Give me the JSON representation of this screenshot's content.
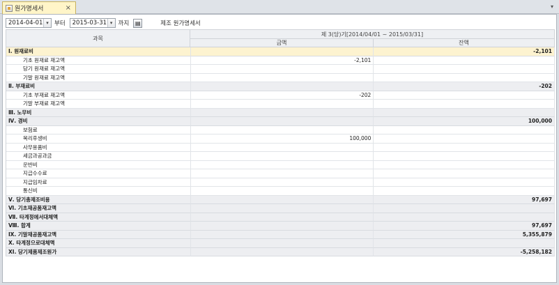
{
  "tab": {
    "label": "원가명세서",
    "close": "×",
    "menu": "▾"
  },
  "filter": {
    "from": "2014-04-01",
    "from_suffix": "부터",
    "to": "2015-03-31",
    "to_suffix": "까지",
    "print_icon": "printer-icon",
    "report_title": "제조 원가명세서"
  },
  "header": {
    "item_col": "과목",
    "period": "제 3(당)기[2014/04/01 ~ 2015/03/31]",
    "amount_col": "금액",
    "balance_col": "잔액"
  },
  "rows": [
    {
      "label": "Ⅰ. 원재료비",
      "amount": "",
      "balance": "-2,101",
      "type": "cat"
    },
    {
      "label": "기초 원재료 재고액",
      "amount": "-2,101",
      "balance": "",
      "type": "sub"
    },
    {
      "label": "당기 원재료 재고액",
      "amount": "",
      "balance": "",
      "type": "sub"
    },
    {
      "label": "기말 원재료 재고액",
      "amount": "",
      "balance": "",
      "type": "sub"
    },
    {
      "label": "Ⅱ. 부재료비",
      "amount": "",
      "balance": "-202",
      "type": "cat"
    },
    {
      "label": "기초 부재료 재고액",
      "amount": "-202",
      "balance": "",
      "type": "sub"
    },
    {
      "label": "기말 부재료 재고액",
      "amount": "",
      "balance": "",
      "type": "sub"
    },
    {
      "label": "Ⅲ. 노무비",
      "amount": "",
      "balance": "",
      "type": "cat"
    },
    {
      "label": "Ⅳ. 경비",
      "amount": "",
      "balance": "100,000",
      "type": "cat"
    },
    {
      "label": "보험료",
      "amount": "",
      "balance": "",
      "type": "sub"
    },
    {
      "label": "복리후생비",
      "amount": "100,000",
      "balance": "",
      "type": "sub"
    },
    {
      "label": "사무용품비",
      "amount": "",
      "balance": "",
      "type": "sub"
    },
    {
      "label": "세금과공과금",
      "amount": "",
      "balance": "",
      "type": "sub"
    },
    {
      "label": "운반비",
      "amount": "",
      "balance": "",
      "type": "sub"
    },
    {
      "label": "지급수수료",
      "amount": "",
      "balance": "",
      "type": "sub"
    },
    {
      "label": "지급임차료",
      "amount": "",
      "balance": "",
      "type": "sub"
    },
    {
      "label": "통신비",
      "amount": "",
      "balance": "",
      "type": "sub"
    },
    {
      "label": "Ⅴ. 당기총제조비용",
      "amount": "",
      "balance": "97,697",
      "type": "cat"
    },
    {
      "label": "Ⅵ. 기초재공품재고액",
      "amount": "",
      "balance": "",
      "type": "cat"
    },
    {
      "label": "Ⅶ. 타계정에서대체액",
      "amount": "",
      "balance": "",
      "type": "cat"
    },
    {
      "label": "Ⅷ. 합계",
      "amount": "",
      "balance": "97,697",
      "type": "cat"
    },
    {
      "label": "Ⅸ. 기말재공품재고액",
      "amount": "",
      "balance": "5,355,879",
      "type": "cat"
    },
    {
      "label": "Ⅹ. 타계정으로대체액",
      "amount": "",
      "balance": "",
      "type": "cat"
    },
    {
      "label": "ⅩⅠ. 당기제품제조원가",
      "amount": "",
      "balance": "-5,258,182",
      "type": "cat"
    }
  ]
}
